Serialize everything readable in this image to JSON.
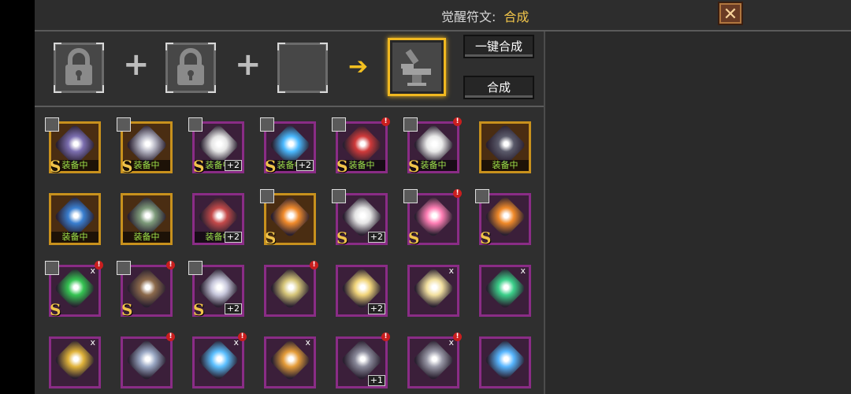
{
  "header": {
    "label": "觉醒符文:",
    "mode": "合成",
    "close_icon": "close-icon"
  },
  "combine": {
    "arrow": "➔",
    "plus": "+",
    "one_click_label": "一键合成",
    "synthesize_label": "合成",
    "result_icon": "anvil-icon"
  },
  "rune_labels": {
    "equipped": "装备中",
    "grade_s": "S",
    "plus_two": "+2",
    "plus_one": "+1",
    "count_prefix": "x",
    "alert": "!"
  },
  "runes": [
    {
      "frame": "gold",
      "color": "#7c6fb0",
      "grade": "S",
      "equipped": true,
      "badge": true
    },
    {
      "frame": "gold",
      "color": "#b6b6c4",
      "grade": "S",
      "equipped": true,
      "badge": true
    },
    {
      "frame": "purple",
      "color": "#e6e6e6",
      "grade": "S",
      "equipped": true,
      "badge": true,
      "level": "+2"
    },
    {
      "frame": "purple",
      "color": "#4ab9ff",
      "grade": "S",
      "equipped": true,
      "badge": true,
      "level": "+2"
    },
    {
      "frame": "purple",
      "color": "#d03a3a",
      "grade": "S",
      "equipped": true,
      "badge": true,
      "alert": true
    },
    {
      "frame": "purple",
      "color": "#e9e9e9",
      "grade": "S",
      "equipped": true,
      "badge": true,
      "alert": true
    },
    {
      "frame": "gold",
      "color": "#5a5a6a",
      "equipped": true
    },
    {
      "frame": "gold",
      "color": "#3a7fd0",
      "equipped": true
    },
    {
      "frame": "gold",
      "color": "#7d9a7a",
      "equipped": true
    },
    {
      "frame": "purple",
      "color": "#c44a4a",
      "equipped": true,
      "level": "+2"
    },
    {
      "frame": "gold",
      "color": "#f18b2c",
      "grade": "S",
      "badge": true
    },
    {
      "frame": "purple",
      "color": "#e5e5e5",
      "grade": "S",
      "badge": true,
      "level": "+2"
    },
    {
      "frame": "purple",
      "color": "#ff7fb5",
      "grade": "S",
      "badge": true,
      "alert": true
    },
    {
      "frame": "purple",
      "color": "#f08a2a",
      "grade": "S",
      "badge": true
    },
    {
      "frame": "purple",
      "color": "#35c452",
      "grade": "S",
      "badge": true,
      "alert": true,
      "count": "x"
    },
    {
      "frame": "purple",
      "color": "#8c6a4c",
      "grade": "S",
      "badge": true,
      "alert": true
    },
    {
      "frame": "purple",
      "color": "#c8c8dc",
      "grade": "S",
      "badge": true,
      "level": "+2"
    },
    {
      "frame": "purple",
      "color": "#d6c67a",
      "alert": true
    },
    {
      "frame": "purple",
      "color": "#f1d57b",
      "level": "+2"
    },
    {
      "frame": "purple",
      "color": "#f2e0a0",
      "count": "x"
    },
    {
      "frame": "purple",
      "color": "#3cd08a",
      "count": "x"
    },
    {
      "frame": "purple",
      "color": "#e0b33a",
      "count": "x"
    },
    {
      "frame": "purple",
      "color": "#9aa8c4",
      "alert": true
    },
    {
      "frame": "purple",
      "color": "#5cc0ff",
      "count": "x",
      "alert": true
    },
    {
      "frame": "purple",
      "color": "#e59d3a",
      "count": "x"
    },
    {
      "frame": "purple",
      "color": "#8a8a9a",
      "alert": true,
      "level": "+1"
    },
    {
      "frame": "purple",
      "color": "#9a9aa8",
      "count": "x",
      "alert": true
    },
    {
      "frame": "purple",
      "color": "#58b6ff"
    }
  ]
}
